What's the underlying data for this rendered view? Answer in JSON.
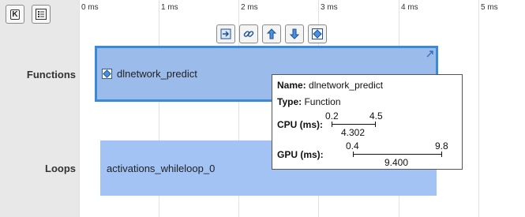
{
  "toolbar_left": {
    "k_label": "K",
    "k_icon": "keyboard-k-icon",
    "list_icon": "list-icon"
  },
  "rows": {
    "functions": "Functions",
    "loops": "Loops"
  },
  "axis": {
    "ticks": [
      "0 ms",
      "1 ms",
      "2 ms",
      "3 ms",
      "4 ms",
      "5 ms"
    ]
  },
  "toolbar_icons": [
    "navigate-to-code-icon",
    "link-icon",
    "go-to-parent-icon",
    "go-to-child-icon",
    "function-icon"
  ],
  "function_bar": {
    "label": "dlnetwork_predict",
    "icon": "function-icon",
    "expand_icon": "expand-arrow-icon"
  },
  "loop_bar": {
    "label": "activations_whileloop_0"
  },
  "tooltip": {
    "name_label": "Name:",
    "name_value": "dlnetwork_predict",
    "type_label": "Type:",
    "type_value": "Function",
    "cpu_label": "CPU (ms):",
    "cpu_start": "0.2",
    "cpu_end": "4.5",
    "cpu_duration": "4.302",
    "gpu_label": "GPU (ms):",
    "gpu_start": "0.4",
    "gpu_end": "9.8",
    "gpu_duration": "9.400"
  },
  "colors": {
    "function_bar": "#9bbcea",
    "function_border": "#3a8ad6",
    "loop_bar": "#a3c3f5",
    "left_pane": "#e8e8e8"
  }
}
